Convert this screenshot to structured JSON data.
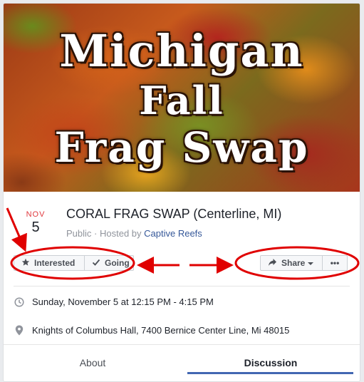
{
  "cover": {
    "line1": "Michigan",
    "line2": "Fall",
    "line3": "Frag Swap"
  },
  "event": {
    "month": "NOV",
    "day": "5",
    "title": "CORAL FRAG SWAP (Centerline, MI)",
    "visibility": "Public",
    "separator": " · ",
    "hosted_by_prefix": "Hosted by ",
    "host": "Captive Reefs"
  },
  "actions": {
    "interested_label": "Interested",
    "going_label": "Going",
    "share_label": "Share",
    "more_label": "•••"
  },
  "details": {
    "time": "Sunday, November 5 at 12:15 PM - 4:15 PM",
    "location": "Knights of Columbus Hall, 7400 Bernice Center Line, Mi 48015"
  },
  "tabs": [
    {
      "label": "About",
      "active": false
    },
    {
      "label": "Discussion",
      "active": true
    }
  ],
  "colors": {
    "accent": "#4267b2",
    "month": "#e0393e",
    "link": "#365899",
    "annotation": "#e00000"
  },
  "icons": [
    "star-icon",
    "checkmark-icon",
    "share-arrow-icon",
    "caret-down-icon",
    "clock-icon",
    "location-pin-icon"
  ]
}
